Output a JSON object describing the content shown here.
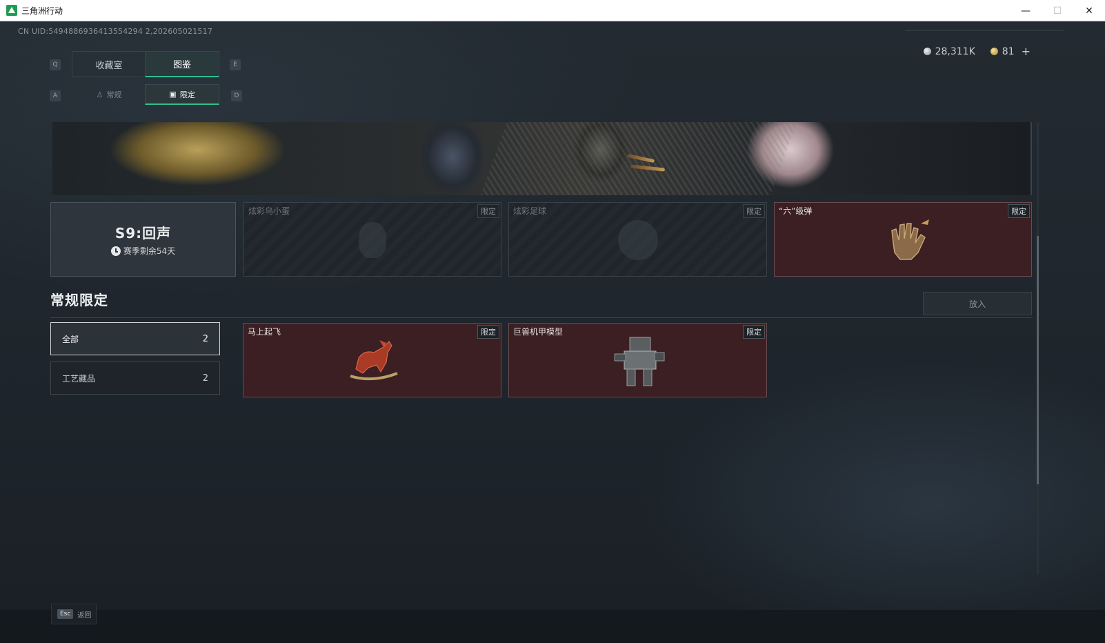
{
  "window": {
    "title": "三角洲行动",
    "minimize": "—",
    "maximize": "☐",
    "close": "✕"
  },
  "uid": "CN UID:5494886936413554294 2,202605021517",
  "currency": {
    "silver": "28,311K",
    "gold": "81",
    "plus": "+"
  },
  "main_tabs": {
    "prev_key": "Q",
    "next_key": "E",
    "items": [
      {
        "label": "收藏室",
        "active": false
      },
      {
        "label": "图鉴",
        "active": true
      }
    ]
  },
  "sub_tabs": {
    "prev_key": "A",
    "next_key": "D",
    "items": [
      {
        "label": "常规",
        "active": false
      },
      {
        "label": "限定",
        "active": true
      }
    ]
  },
  "season": {
    "title": "S9:回声",
    "remaining": "赛季剩余54天"
  },
  "season_items": [
    {
      "name": "炫彩乌小蛋",
      "tag": "限定",
      "owned": false
    },
    {
      "name": "炫彩足球",
      "tag": "限定",
      "owned": false
    },
    {
      "name": "“六”级弹",
      "tag": "限定",
      "owned": true
    }
  ],
  "section": {
    "title": "常规限定",
    "put_button": "放入"
  },
  "filters": [
    {
      "label": "全部",
      "count": "2",
      "active": true
    },
    {
      "label": "工艺藏品",
      "count": "2",
      "active": false
    }
  ],
  "items": [
    {
      "name": "马上起飞",
      "tag": "限定"
    },
    {
      "name": "巨兽机甲模型",
      "tag": "限定"
    }
  ],
  "footer": {
    "key": "Esc",
    "label": "返回"
  }
}
